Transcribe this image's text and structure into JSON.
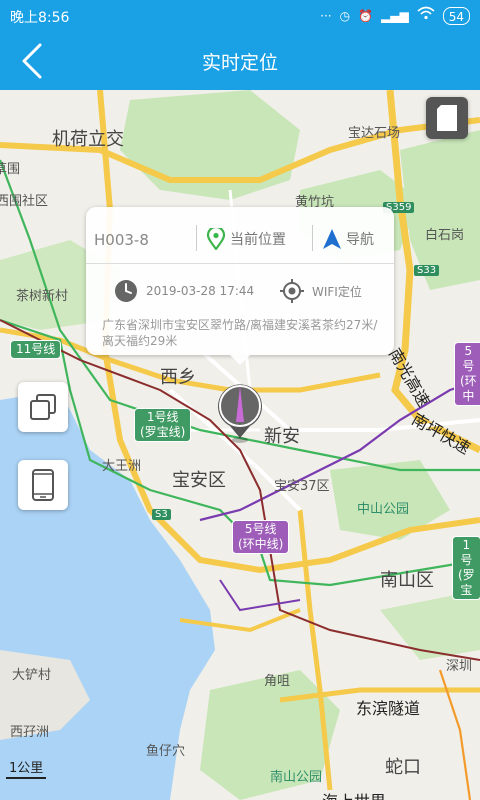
{
  "status_bar": {
    "time": "晚上8:56",
    "battery": "54",
    "icons": [
      "dots-icon",
      "alarm-icon",
      "clock-icon",
      "signal-icon",
      "wifi-icon",
      "battery-icon"
    ]
  },
  "header": {
    "title": "实时定位",
    "back_icon": "chevron-left-icon"
  },
  "popup": {
    "device_name": "H003-8",
    "current_location_label": "当前位置",
    "navigate_label": "导航",
    "timestamp": "2019-03-28 17:44",
    "location_type": "WIFI定位",
    "address": "广东省深圳市宝安区翠竹路/离福建安溪茗茶约27米/离天福约29米"
  },
  "map": {
    "labels": {
      "jihe": "机荷立交",
      "baoda": "宝达石场",
      "huangzhukeng": "黄竹坑",
      "baishikeng": "白石岗",
      "xishan": "西乡",
      "xinan": "新安",
      "baoan": "宝安区",
      "dawangzhou": "大王洲",
      "baoan37": "宝安37区",
      "zhongshan": "中山公园",
      "nanshan": "南山区",
      "jiaoju": "角咀",
      "dongbin": "东滨隧道",
      "dachan": "大铲村",
      "xizaizhou": "西孖洲",
      "yuzaixue": "鱼仔穴",
      "nanshanpark": "南山公园",
      "shekou": "蛇口",
      "shenzhen": "深圳",
      "chashu": "茶树新村",
      "xiweishe": "西围社区",
      "gonghe": "草围",
      "nanguang": "南光高速",
      "nanping": "南坪快速",
      "haishang": "海上世界"
    },
    "metro": {
      "line11": "11号线",
      "line1a": "1号线",
      "line1b": "(罗宝线)",
      "line5a": "5号线",
      "line5b": "(环中线)",
      "line5c_a": "5号",
      "line5c_b": "(环中",
      "line1c_a": "1号",
      "line1c_b": "(罗宝"
    },
    "road_tags": {
      "s33": "S33",
      "s3": "S3",
      "s359": "S359"
    },
    "scale": "1公里"
  },
  "side_buttons": {
    "top_right": "sim-card-icon",
    "layers": "layers-icon",
    "phone": "phone-icon"
  },
  "colors": {
    "primary": "#1aa0e4",
    "water": "#aad3f5",
    "park": "#c8e6b8",
    "highway": "#f5c94a",
    "metro_green": "#3f9a63",
    "metro_purple": "#9d5db8",
    "pin": "#555555"
  }
}
